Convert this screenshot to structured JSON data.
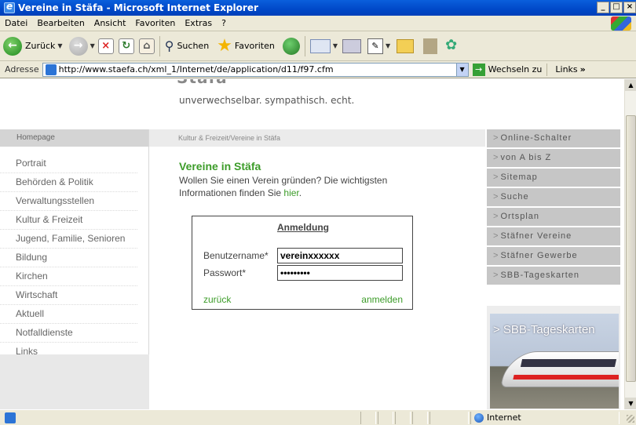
{
  "window": {
    "title": "Vereine in Stäfa - Microsoft Internet Explorer",
    "controls": [
      "_",
      "□",
      "×"
    ]
  },
  "menu": [
    "Datei",
    "Bearbeiten",
    "Ansicht",
    "Favoriten",
    "Extras",
    "?"
  ],
  "toolbar": {
    "back_label": "Zurück",
    "search_label": "Suchen",
    "favorites_label": "Favoriten"
  },
  "address": {
    "label": "Adresse",
    "url": "http://www.staefa.ch/xml_1/Internet/de/application/d11/f97.cfm",
    "go_label": "Wechseln zu",
    "links_label": "Links",
    "links_more": "»"
  },
  "site": {
    "brand_cut": "Stäfa",
    "tagline": "unverwechselbar. sympathisch. echt."
  },
  "left_nav": {
    "header": "Homepage",
    "items": [
      "Portrait",
      "Behörden & Politik",
      "Verwaltungsstellen",
      "Kultur & Freizeit",
      "Jugend, Familie, Senioren",
      "Bildung",
      "Kirchen",
      "Wirtschaft",
      "Aktuell",
      "Notfalldienste",
      "Links"
    ]
  },
  "breadcrumb": "Kultur & Freizeit/Vereine in Stäfa",
  "content": {
    "title": "Vereine in Stäfa",
    "intro": "Wollen Sie einen Verein gründen? Die wichtigsten Informationen finden Sie ",
    "intro_link": "hier",
    "intro_end": "."
  },
  "login": {
    "title": "Anmeldung",
    "username_label": "Benutzername*",
    "username_value": "vereinxxxxxx",
    "password_label": "Passwort*",
    "password_value": "•••••••••",
    "back_link": "zurück",
    "submit_link": "anmelden"
  },
  "right_nav": {
    "items": [
      "Online-Schalter",
      "von A bis Z",
      "Sitemap",
      "Suche",
      "Ortsplan",
      "Stäfner Vereine",
      "Stäfner Gewerbe",
      "SBB-Tageskarten"
    ],
    "banner_text": "> SBB-Tageskarten"
  },
  "status": {
    "zone": "Internet"
  }
}
